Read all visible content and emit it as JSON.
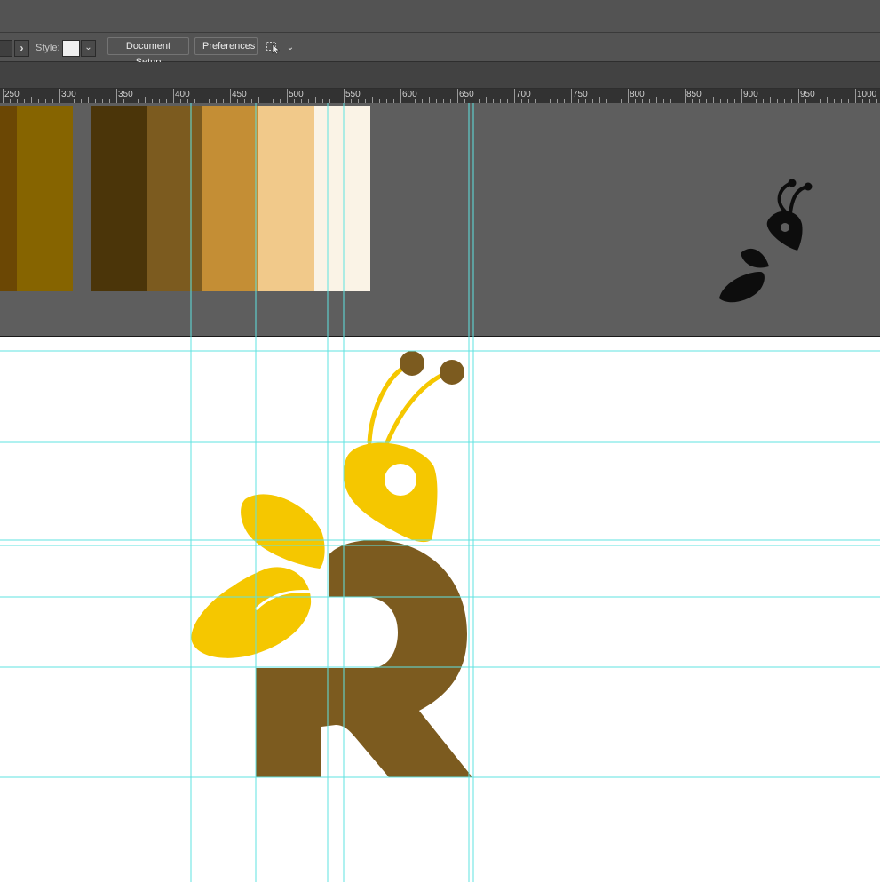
{
  "control_bar": {
    "style_label": "Style:",
    "style_swatch_color": "#efefef",
    "document_setup_label": "Document Setup",
    "preferences_label": "Preferences",
    "arrange_tool_icon": "select-behind-icon"
  },
  "ruler": {
    "labels": [
      "250",
      "300",
      "350",
      "400",
      "450",
      "500",
      "550",
      "600",
      "650",
      "700",
      "750",
      "800",
      "850",
      "900",
      "950",
      "1000"
    ]
  },
  "palette": {
    "swatches": [
      "#6b4704",
      "#866400",
      "#4b3509",
      "#7c5b1f",
      "#c48e35",
      "#f1c98a",
      "#faf3e6"
    ]
  },
  "logo": {
    "letter_color": "#7c5b1f",
    "wing_color": "#f5c700",
    "antenna_tip_color": "#7c5b1f",
    "thumbnail_color": "#0d0d0d"
  },
  "guide_color": "#5fe3e0"
}
